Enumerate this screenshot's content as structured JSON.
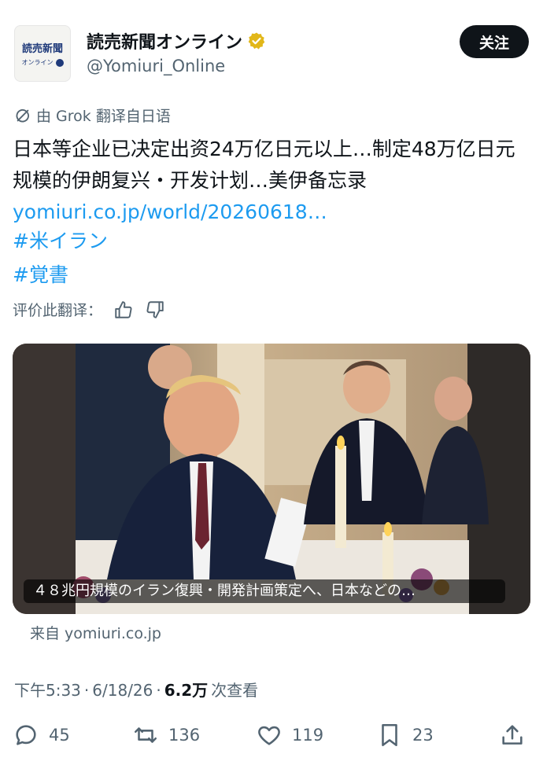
{
  "account": {
    "avatar_title": "読売新聞",
    "avatar_sub": "オンライン",
    "display_name": "読売新聞オンライン",
    "handle": "@Yomiuri_Online",
    "verified_color": "#e2b719"
  },
  "follow_label": "关注",
  "translation_note": "由 Grok 翻译自日语",
  "body_text": "日本等企业已决定出资24万亿日元以上…制定48万亿日元规模的伊朗复兴・开发计划…美伊备忘录",
  "link": "yomiuri.co.jp/world/20260618…",
  "hashtags": [
    "#米イラン",
    "#覚書"
  ],
  "rate_label": "评价此翻译：",
  "media": {
    "caption": "４８兆円規模のイラン復興・開発計画策定へ、日本などの…",
    "source": "来自 yomiuri.co.jp"
  },
  "meta": {
    "time": "下午5:33",
    "date": "6/18/26",
    "views_count": "6.2万",
    "views_label": "次查看"
  },
  "actions": {
    "replies": "45",
    "reposts": "136",
    "likes": "119",
    "bookmarks": "23"
  },
  "colors": {
    "accent": "#1d9bf0",
    "text": "#0f1419",
    "muted": "#536471"
  }
}
